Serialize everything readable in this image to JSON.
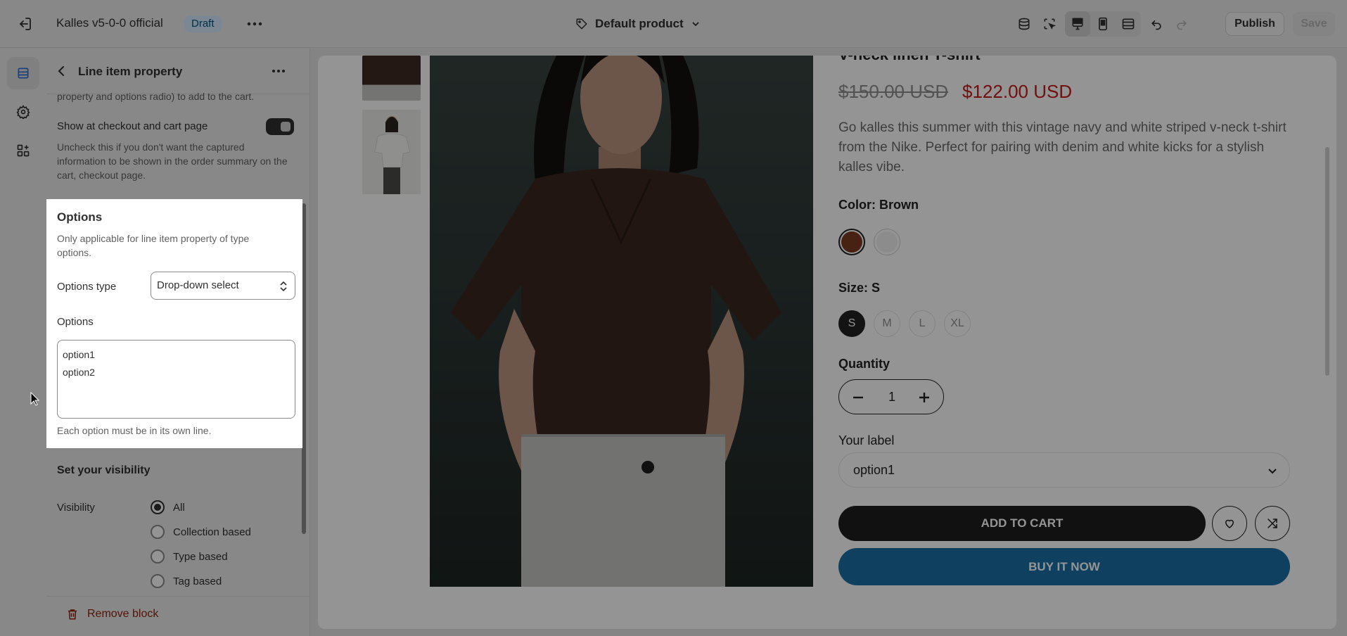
{
  "topbar": {
    "store_name": "Kalles v5-0-0 official",
    "status_badge": "Draft",
    "template_name": "Default product",
    "publish_label": "Publish",
    "save_label": "Save"
  },
  "sidebar": {
    "title": "Line item property",
    "intro_text": "property and options radio) to add to the cart.",
    "show_checkout_label": "Show at checkout and cart page",
    "show_checkout_enabled": true,
    "show_checkout_help": "Uncheck this if you don't want the captured information to be shown in the order summary on the cart, checkout page.",
    "options_card": {
      "title": "Options",
      "description": "Only applicable for line item property of type options.",
      "type_label": "Options type",
      "type_value": "Drop-down select",
      "options_label": "Options",
      "options_lines": [
        "option1",
        "option2"
      ],
      "help": "Each option must be in its own line."
    },
    "visibility": {
      "title": "Set your visibility",
      "label": "Visibility",
      "choices": [
        "All",
        "Collection based",
        "Type based",
        "Tag based"
      ],
      "selected": "All"
    },
    "remove_label": "Remove block"
  },
  "preview": {
    "product_title": "V-neck linen T-shirt",
    "price_compare": "$150.00 USD",
    "price_sale": "$122.00 USD",
    "description": "Go kalles this summer with this vintage navy and white striped v-neck t-shirt from the Nike. Perfect for pairing with denim and white kicks for a stylish kalles vibe.",
    "color_label": "Color: Brown",
    "colors": [
      "#7a3a1f",
      "#f2f2f2"
    ],
    "size_label": "Size: S",
    "sizes": [
      "S",
      "M",
      "L",
      "XL"
    ],
    "selected_size": "S",
    "quantity_label": "Quantity",
    "quantity": "1",
    "custom_label": "Your label",
    "custom_value": "option1",
    "add_to_cart": "ADD TO CART",
    "buy_now": "BUY IT NOW"
  },
  "colors": {
    "sale_price": "#c71a1a",
    "buy_now": "#1a6ea5",
    "remove": "#8e1f0b",
    "draft_badge_bg": "#d5ebff"
  }
}
